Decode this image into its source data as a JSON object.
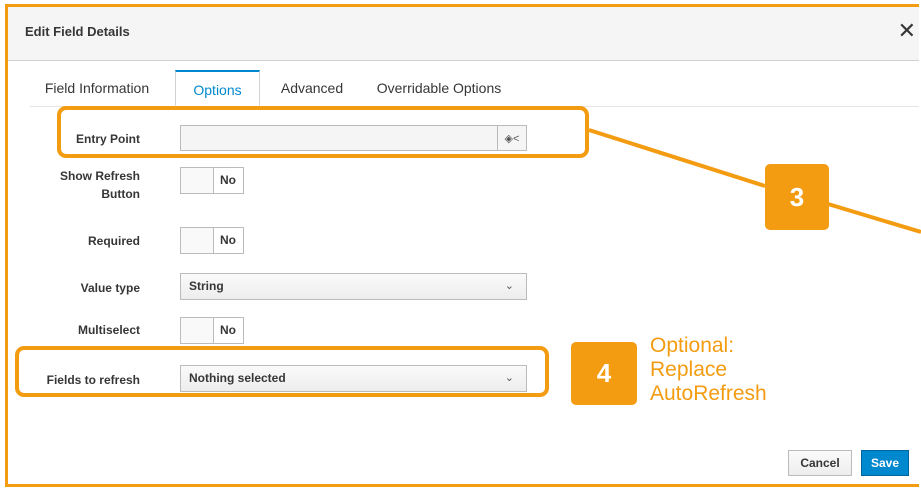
{
  "dialog": {
    "title": "Edit Field Details",
    "close_glyph": "✕"
  },
  "tabs": [
    "Field Information",
    "Options",
    "Advanced",
    "Overridable Options"
  ],
  "active_tab": "Options",
  "fields": {
    "entry_point": {
      "label": "Entry Point",
      "value": ""
    },
    "show_refresh": {
      "label_line1": "Show Refresh",
      "label_line2": "Button",
      "value": "No"
    },
    "required": {
      "label": "Required",
      "value": "No"
    },
    "value_type": {
      "label": "Value type",
      "value": "String"
    },
    "multiselect": {
      "label": "Multiselect",
      "value": "No"
    },
    "fields_to_refresh": {
      "label": "Fields to refresh",
      "value": "Nothing selected"
    }
  },
  "annotations": {
    "badge3": "3",
    "badge4": "4",
    "note_line1": "Optional:",
    "note_line2": "Replace",
    "note_line3": "AutoRefresh",
    "accent_color": "#f39c12"
  },
  "footer": {
    "cancel_label": "Cancel",
    "save_label": "Save"
  },
  "icons": {
    "close": "close-icon",
    "tree": "tree-icon",
    "caret": "chevron-down-icon"
  }
}
